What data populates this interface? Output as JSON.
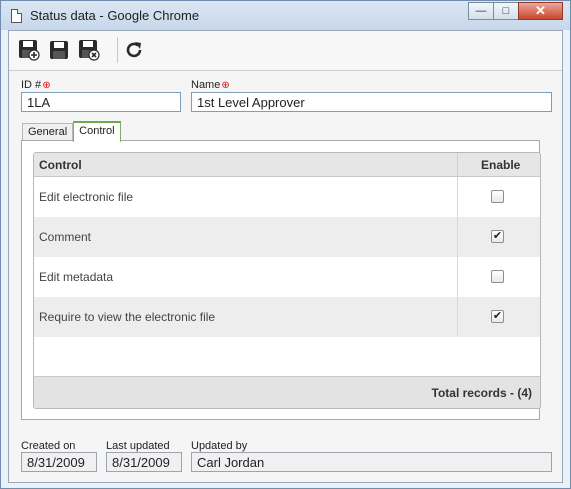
{
  "window": {
    "title": "Status data - Google Chrome",
    "controls": {
      "minimize": "—",
      "maximize": "□",
      "close": "✕"
    }
  },
  "toolbar": {
    "buttons": [
      {
        "name": "save-new-icon"
      },
      {
        "name": "save-icon"
      },
      {
        "name": "save-close-icon"
      },
      {
        "name": "refresh-icon"
      }
    ]
  },
  "form": {
    "id_label": "ID #",
    "id_value": "1LA",
    "name_label": "Name",
    "name_value": "1st Level Approver",
    "required_marker": "⊕"
  },
  "tabs": [
    {
      "label": "General",
      "active": false
    },
    {
      "label": "Control",
      "active": true
    }
  ],
  "grid": {
    "headers": {
      "control": "Control",
      "enable": "Enable"
    },
    "rows": [
      {
        "control": "Edit electronic file",
        "enabled": false
      },
      {
        "control": "Comment",
        "enabled": true
      },
      {
        "control": "Edit metadata",
        "enabled": false
      },
      {
        "control": "Require to view the electronic file",
        "enabled": true
      }
    ],
    "footer": "Total records  - (4)"
  },
  "footer_fields": {
    "created_on_label": "Created on",
    "created_on": "8/31/2009",
    "last_updated_label": "Last updated",
    "last_updated": "8/31/2009",
    "updated_by_label": "Updated by",
    "updated_by": "Carl Jordan"
  }
}
